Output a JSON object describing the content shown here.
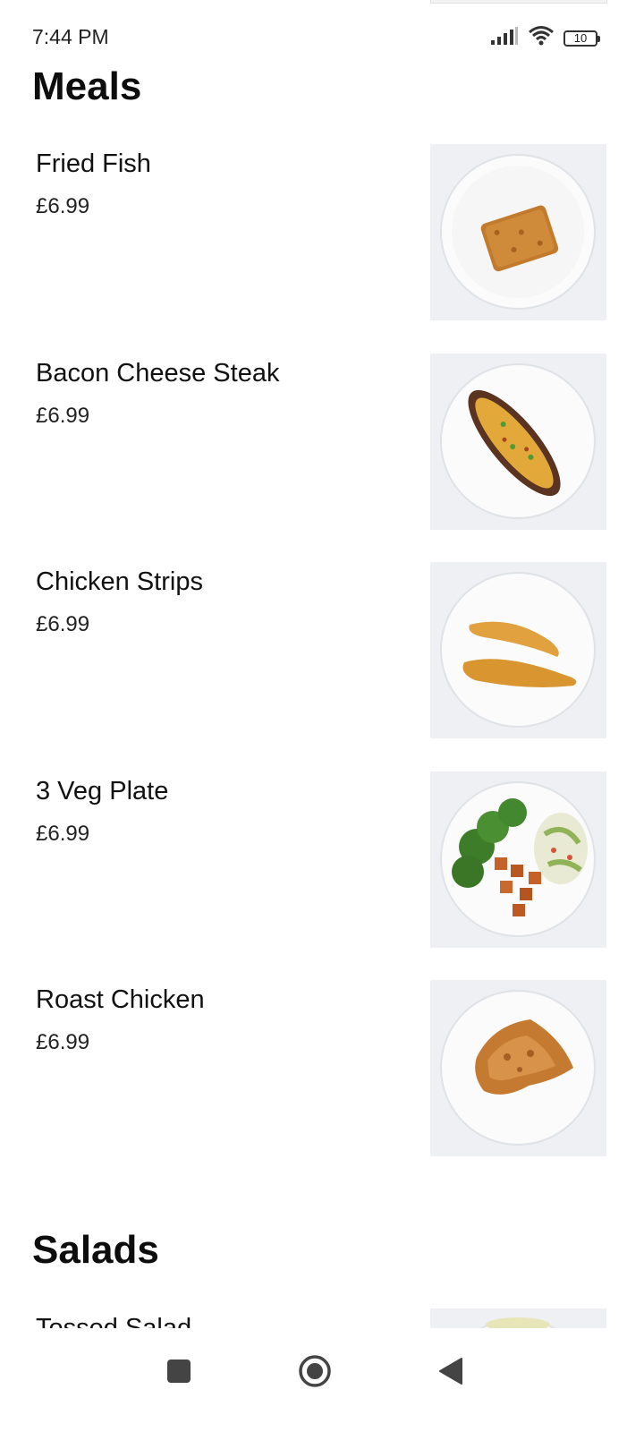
{
  "status_bar": {
    "time": "7:44 PM",
    "battery_level": "10",
    "icons": [
      "signal-icon",
      "wifi-icon",
      "battery-icon"
    ]
  },
  "sections": [
    {
      "title": "Meals",
      "items": [
        {
          "name": "Fried Fish",
          "price": "£6.99",
          "image_icon": "fried-fish-plate-image"
        },
        {
          "name": "Bacon Cheese Steak",
          "price": "£6.99",
          "image_icon": "bacon-cheese-steak-plate-image"
        },
        {
          "name": "Chicken Strips",
          "price": "£6.99",
          "image_icon": "chicken-strips-plate-image"
        },
        {
          "name": "3 Veg Plate",
          "price": "£6.99",
          "image_icon": "veg-plate-image"
        },
        {
          "name": "Roast Chicken",
          "price": "£6.99",
          "image_icon": "roast-chicken-plate-image"
        }
      ]
    },
    {
      "title": "Salads",
      "items": [
        {
          "name": "Tossed Salad",
          "image_icon": "tossed-salad-plate-image"
        }
      ]
    }
  ],
  "nav_bar": {
    "buttons": [
      "recents-square-icon",
      "home-circle-icon",
      "back-triangle-icon"
    ]
  },
  "colors": {
    "background": "#ffffff",
    "text": "#111111",
    "image_background": "#eef0f3"
  }
}
